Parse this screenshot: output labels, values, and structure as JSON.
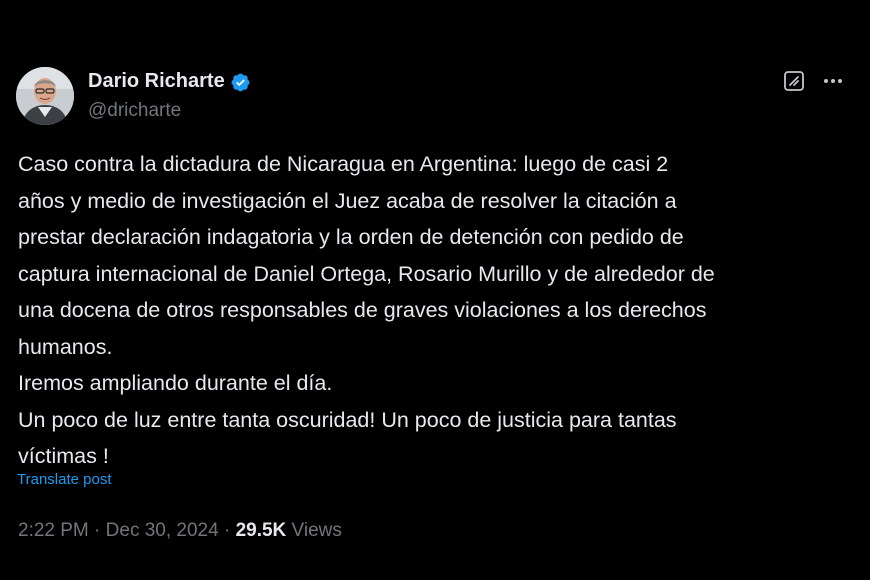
{
  "author": {
    "name": "Dario Richarte",
    "handle": "@dricharte",
    "verified": true
  },
  "icons": {
    "avatar": "profile-photo",
    "verified": "verified-badge-icon",
    "grok": "grok-icon",
    "more": "more-options-icon"
  },
  "colors": {
    "background": "#000000",
    "text": "#e7e9ea",
    "secondary": "#71767b",
    "link": "#1d9bf0",
    "verified": "#1d9bf0"
  },
  "tweet": {
    "lines": [
      "Caso contra la dictadura de Nicaragua en Argentina: luego de casi 2",
      "años y medio de investigación el Juez acaba de resolver la citación a",
      "prestar declaración indagatoria y la orden de detención con pedido de",
      "captura internacional de Daniel Ortega, Rosario Murillo y de alrededor de",
      "una docena  de otros responsables de graves violaciones a los derechos",
      "humanos.",
      "Iremos ampliando durante el día.",
      "Un poco de luz entre tanta oscuridad! Un poco de justicia para tantas",
      "víctimas !"
    ],
    "translate_label": "Translate post"
  },
  "meta": {
    "time": "2:22 PM",
    "separator": " · ",
    "date": "Dec 30, 2024",
    "views_count": "29.5K",
    "views_label": " Views"
  }
}
